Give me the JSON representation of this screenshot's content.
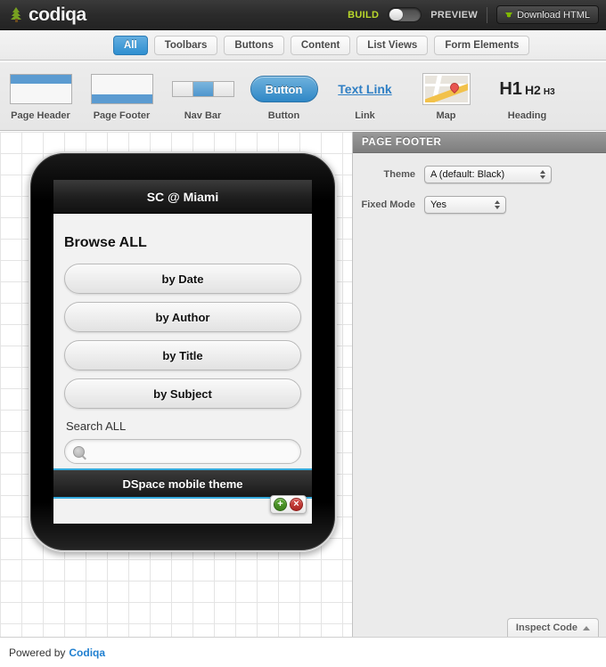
{
  "topbar": {
    "logo_text": "codiqa",
    "build_label": "BUILD",
    "preview_label": "PREVIEW",
    "download_label": "Download HTML",
    "toggle_state": "build"
  },
  "tabs": [
    {
      "label": "All",
      "active": true
    },
    {
      "label": "Toolbars",
      "active": false
    },
    {
      "label": "Buttons",
      "active": false
    },
    {
      "label": "Content",
      "active": false
    },
    {
      "label": "List Views",
      "active": false
    },
    {
      "label": "Form Elements",
      "active": false
    }
  ],
  "palette": [
    {
      "label": "Page Header",
      "icon": "page-header-icon"
    },
    {
      "label": "Page Footer",
      "icon": "page-footer-icon"
    },
    {
      "label": "Nav Bar",
      "icon": "nav-bar-icon"
    },
    {
      "label": "Button",
      "icon": "button-icon",
      "art_text": "Button"
    },
    {
      "label": "Link",
      "icon": "link-icon",
      "art_text": "Text Link"
    },
    {
      "label": "Map",
      "icon": "map-icon"
    },
    {
      "label": "Heading",
      "icon": "heading-icon",
      "h1": "H1",
      "h2": "H2",
      "h3": "H3"
    }
  ],
  "phone": {
    "header_title": "SC @ Miami",
    "heading": "Browse ALL",
    "buttons": [
      {
        "label": "by Date"
      },
      {
        "label": "by Author"
      },
      {
        "label": "by Title"
      },
      {
        "label": "by Subject"
      }
    ],
    "search_label": "Search ALL",
    "search_value": "",
    "search_placeholder": "",
    "footer_text": "DSpace mobile theme",
    "selection_actions": {
      "add": "+",
      "delete": "×"
    }
  },
  "panel": {
    "title": "PAGE FOOTER",
    "fields": [
      {
        "label": "Theme",
        "value": "A (default: Black)"
      },
      {
        "label": "Fixed Mode",
        "value": "Yes"
      }
    ],
    "inspect_label": "Inspect Code"
  },
  "footer": {
    "powered_text": "Powered by",
    "brand": "Codiqa"
  },
  "colors": {
    "accent_blue": "#2f8fd0",
    "selection_blue": "#35aadc",
    "build_green": "#b9d72b",
    "brand_link": "#1f7fd0"
  }
}
